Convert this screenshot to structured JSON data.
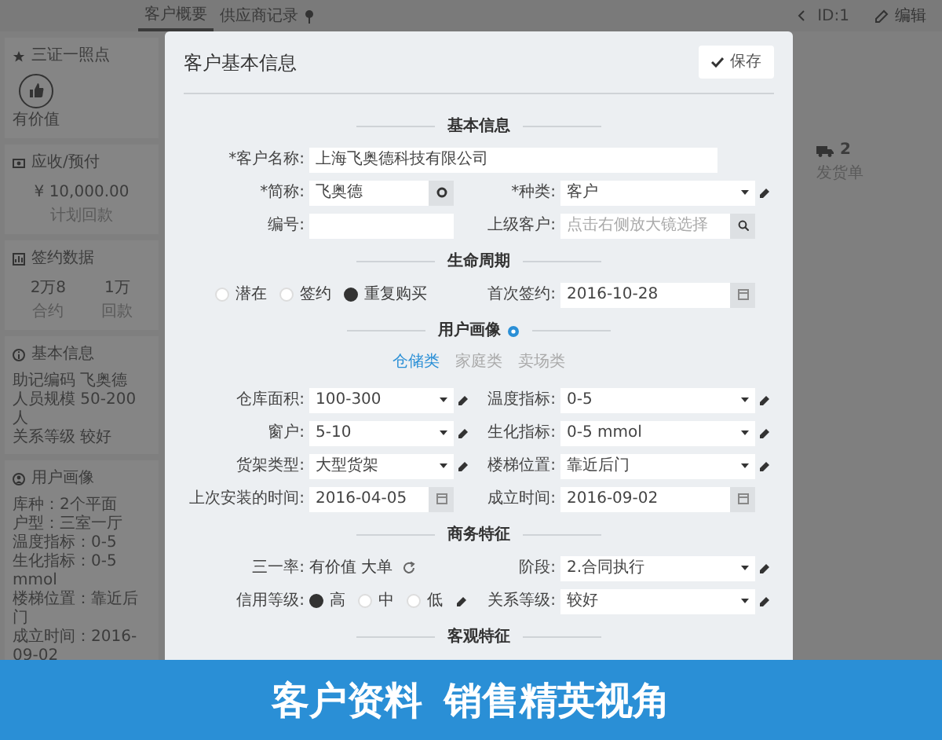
{
  "top_bar": {
    "tabs": [
      {
        "label": "客户概要",
        "selected": true
      },
      {
        "label": "供应商记录",
        "selected": false
      }
    ],
    "id_text": "ID:1",
    "edit_link": "编辑"
  },
  "cards": [
    {
      "kind": "badges",
      "title": "三证一照点",
      "items": [
        {
          "label": "有价值"
        }
      ]
    },
    {
      "kind": "stats",
      "title": "应收/预付",
      "items": [
        {
          "value": "¥ 10,000.00",
          "label": "计划回款"
        }
      ]
    },
    {
      "kind": "stats",
      "title": "签约数据",
      "items": [
        {
          "value": "2万8",
          "label": "合约"
        },
        {
          "value": "1万",
          "label": "回款"
        }
      ]
    },
    {
      "kind": "lines",
      "title": "基本信息",
      "lines": [
        "助记编码 飞奥德",
        "人员规模 50-200人",
        "关系等级 较好"
      ]
    },
    {
      "kind": "lines",
      "title": "用户画像",
      "lines": [
        "库种：2个平面",
        "户型：三室一厅",
        "温度指标：0-5",
        "生化指标：0-5 mmol",
        "楼梯位置：靠近后门",
        "成立时间：2016-09-02"
      ]
    }
  ],
  "delivery": {
    "count": "2",
    "label": "发货单"
  },
  "modal": {
    "title": "客户基本信息",
    "save_button": "保存",
    "sections": [
      {
        "title": "基本信息",
        "rows": [
          {
            "fields": [
              {
                "kind": "wide",
                "label": "*客户名称:",
                "value": "上海飞奥德科技有限公司"
              }
            ]
          },
          {
            "fields": [
              {
                "kind": "gear",
                "label": "*简称:",
                "value": "飞奥德"
              },
              {
                "kind": "select",
                "label": "*种类:",
                "value": "客户",
                "has_icon": true
              }
            ]
          },
          {
            "fields": [
              {
                "kind": "text",
                "label": "编号:"
              },
              {
                "kind": "lookup",
                "label": "上级客户:",
                "placeholder": "点击右侧放大镜选择"
              }
            ]
          }
        ]
      },
      {
        "title": "生命周期",
        "rows": [
          {
            "fields": [
              {
                "kind": "radios",
                "options": [
                  {
                    "label": "潜在",
                    "selected": false
                  },
                  {
                    "label": "签约",
                    "selected": false
                  },
                  {
                    "label": "重复购买",
                    "selected": true
                  }
                ]
              },
              {
                "kind": "date",
                "label": "首次签约:",
                "value": "2016-10-28"
              }
            ]
          }
        ]
      },
      {
        "title": "用户画像",
        "info": true,
        "tabs": [
          {
            "label": "仓储类",
            "selected": true
          },
          {
            "label": "家庭类",
            "selected": false
          },
          {
            "label": "卖场类",
            "selected": false
          }
        ],
        "rows": [
          {
            "fields": [
              {
                "kind": "select",
                "label": "仓库面积:",
                "value": "100-300",
                "has_icon": true
              },
              {
                "kind": "select",
                "label": "温度指标:",
                "value": "0-5",
                "has_icon": true
              }
            ]
          },
          {
            "fields": [
              {
                "kind": "select",
                "label": "窗户:",
                "value": "5-10",
                "has_icon": true
              },
              {
                "kind": "select",
                "label": "生化指标:",
                "value": "0-5 mmol",
                "has_icon": true
              }
            ]
          },
          {
            "fields": [
              {
                "kind": "select",
                "label": "货架类型:",
                "value": "大型货架",
                "has_icon": true
              },
              {
                "kind": "select",
                "label": "楼梯位置:",
                "value": "靠近后门",
                "has_icon": true
              }
            ]
          },
          {
            "fields": [
              {
                "kind": "date",
                "label": "上次安装的时间:",
                "value": "2016-04-05"
              },
              {
                "kind": "date",
                "label": "成立时间:",
                "value": "2016-09-02"
              }
            ]
          }
        ]
      },
      {
        "title": "商务特征",
        "rows": [
          {
            "fields": [
              {
                "kind": "tags",
                "label": "三一率:",
                "value": "有价值 大单"
              },
              {
                "kind": "select",
                "label": "阶段:",
                "value": "2.合同执行",
                "has_icon": true
              }
            ]
          },
          {
            "fields": [
              {
                "kind": "radios",
                "label": "信用等级:",
                "has_icon": true,
                "options": [
                  {
                    "label": "高",
                    "selected": true
                  },
                  {
                    "label": "中",
                    "selected": false
                  },
                  {
                    "label": "低",
                    "selected": false
                  }
                ]
              },
              {
                "kind": "select",
                "label": "关系等级:",
                "value": "较好",
                "has_icon": true
              }
            ]
          }
        ]
      },
      {
        "title": "客观特征"
      }
    ]
  },
  "banner": {
    "title": "客户资料",
    "subtitle": "销售精英视角"
  }
}
